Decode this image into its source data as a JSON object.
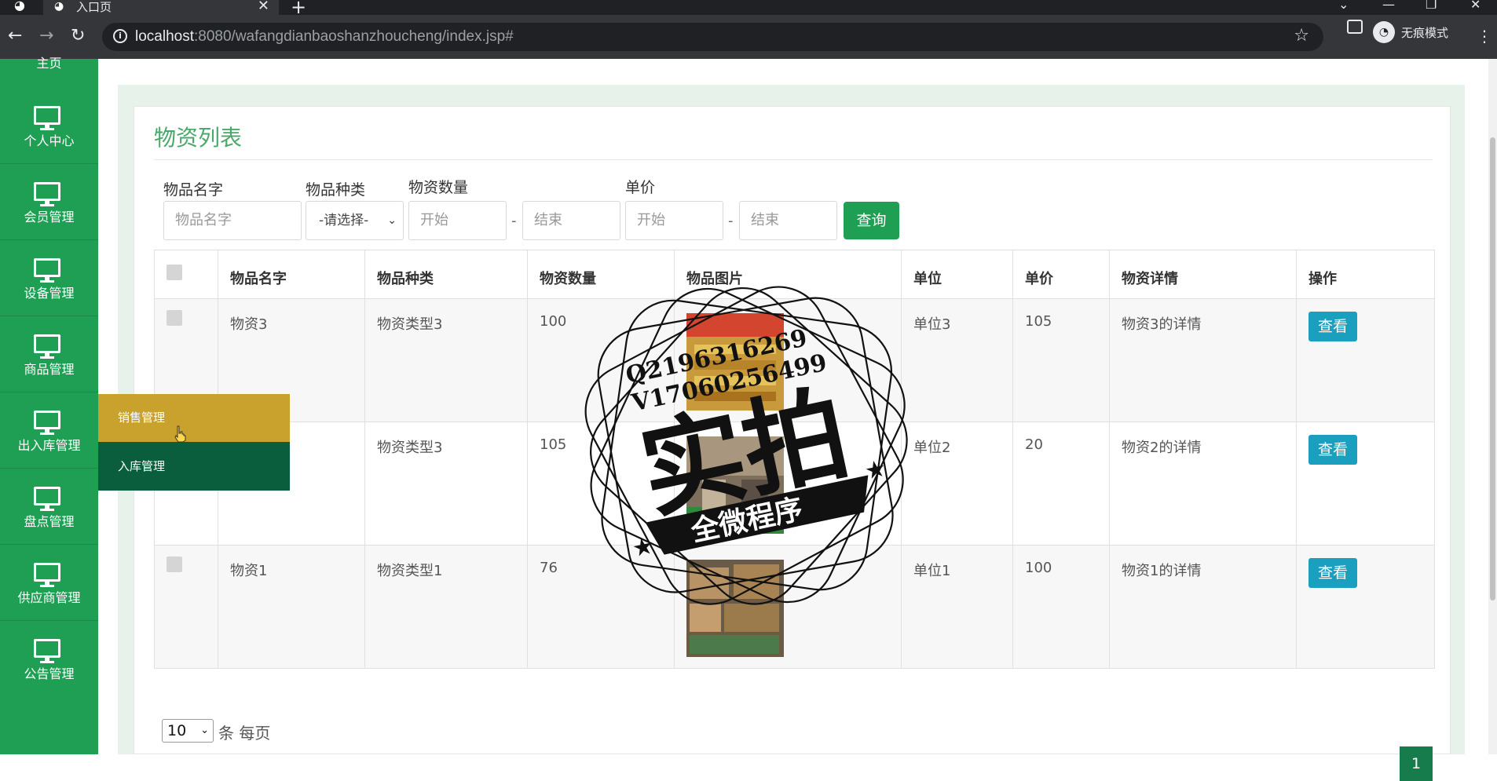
{
  "browser": {
    "tab_title": "入口页",
    "url_host": "localhost",
    "url_rest": ":8080/wafangdianbaoshanzhoucheng/index.jsp#",
    "incognito_label": "无痕模式"
  },
  "sidebar": {
    "top_item_partial": "主页",
    "items": [
      {
        "label": "个人中心"
      },
      {
        "label": "会员管理"
      },
      {
        "label": "设备管理"
      },
      {
        "label": "商品管理"
      },
      {
        "label": "出入库管理"
      },
      {
        "label": "盘点管理"
      },
      {
        "label": "供应商管理"
      },
      {
        "label": "公告管理"
      }
    ],
    "submenu": [
      {
        "label": "销售管理",
        "active": true
      },
      {
        "label": "入库管理",
        "active": false
      }
    ]
  },
  "panel": {
    "title": "物资列表",
    "filters": {
      "name_label": "物品名字",
      "name_placeholder": "物品名字",
      "type_label": "物品种类",
      "type_value": "-请选择-",
      "qty_label": "物资数量",
      "qty_start_placeholder": "开始",
      "qty_end_placeholder": "结束",
      "price_label": "单价",
      "price_start_placeholder": "开始",
      "price_end_placeholder": "结束",
      "separator": "-",
      "query_button": "查询"
    },
    "table": {
      "headers": [
        "物品名字",
        "物品种类",
        "物资数量",
        "物品图片",
        "单位",
        "单价",
        "物资详情",
        "操作"
      ],
      "rows": [
        {
          "name": "物资3",
          "type": "物资类型3",
          "qty": "100",
          "unit": "单位3",
          "price": "105",
          "detail": "物资3的详情",
          "action": "查看"
        },
        {
          "name": "",
          "type": "物资类型3",
          "qty": "105",
          "unit": "单位2",
          "price": "20",
          "detail": "物资2的详情",
          "action": "查看"
        },
        {
          "name": "物资1",
          "type": "物资类型1",
          "qty": "76",
          "unit": "单位1",
          "price": "100",
          "detail": "物资1的详情",
          "action": "查看"
        }
      ]
    },
    "page_size": "10",
    "page_size_suffix": "条 每页",
    "current_page": "1"
  },
  "watermark": {
    "line1": "Q2196316269",
    "line2": "V17060256499",
    "big_text": "实拍",
    "ribbon_text": "全微程序"
  },
  "colors": {
    "sidebar": "#1f9f53",
    "submenu_active": "#c9a12d",
    "submenu_normal": "#0a5e3e",
    "title": "#4aa86a",
    "view_button": "#1a9fbf",
    "pager": "#167c4c"
  }
}
